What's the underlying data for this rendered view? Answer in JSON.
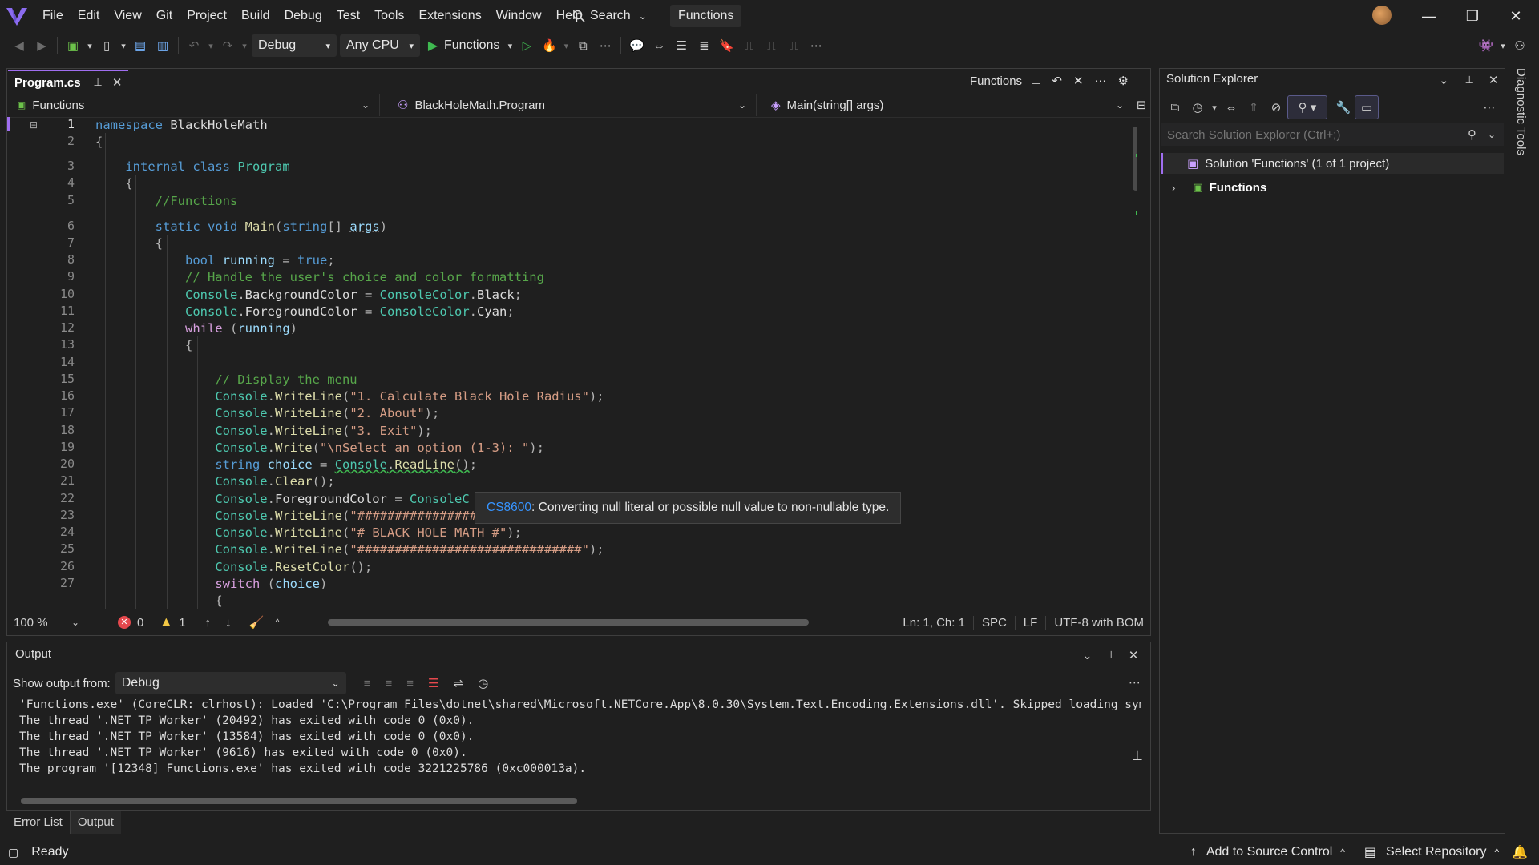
{
  "menu": [
    "File",
    "Edit",
    "View",
    "Git",
    "Project",
    "Build",
    "Debug",
    "Test",
    "Tools",
    "Extensions",
    "Window",
    "Help"
  ],
  "search_label": "Search",
  "solution_title": "Functions",
  "toolbar": {
    "config": "Debug",
    "platform": "Any CPU",
    "run_target": "Functions"
  },
  "editor": {
    "tab_label": "Program.cs",
    "right_title": "Functions",
    "nav_project": "Functions",
    "nav_class": "BlackHoleMath.Program",
    "nav_member": "Main(string[] args)",
    "line_numbers": [
      "1",
      "2",
      "3",
      "4",
      "5",
      "6",
      "7",
      "8",
      "9",
      "10",
      "11",
      "12",
      "13",
      "14",
      "15",
      "16",
      "17",
      "18",
      "19",
      "20",
      "21",
      "22",
      "23",
      "24",
      "25",
      "26",
      "27"
    ],
    "tooltip_code": "CS8600",
    "tooltip_text": ": Converting null literal or possible null value to non-nullable type.",
    "zoom": "100 %",
    "errors": "0",
    "warnings": "1",
    "position": "Ln: 1, Ch: 1",
    "whitespace": "SPC",
    "line_ending": "LF",
    "encoding": "UTF-8 with BOM"
  },
  "output": {
    "title": "Output",
    "show_from_label": "Show output from:",
    "source": "Debug",
    "lines": [
      "'Functions.exe' (CoreCLR: clrhost): Loaded 'C:\\Program Files\\dotnet\\shared\\Microsoft.NETCore.App\\8.0.30\\System.Text.Encoding.Extensions.dll'. Skipped loading symbols. Module",
      "The thread '.NET TP Worker' (20492) has exited with code 0 (0x0).",
      "The thread '.NET TP Worker' (13584) has exited with code 0 (0x0).",
      "The thread '.NET TP Worker' (9616) has exited with code 0 (0x0).",
      "The program '[12348] Functions.exe' has exited with code 3221225786 (0xc000013a)."
    ]
  },
  "bottom_tabs": [
    "Error List",
    "Output"
  ],
  "solution_explorer": {
    "title": "Solution Explorer",
    "search_placeholder": "Search Solution Explorer (Ctrl+;)",
    "solution_label": "Solution 'Functions' (1 of 1 project)",
    "project_label": "Functions"
  },
  "diagnostic_tools": "Diagnostic Tools",
  "statusbar": {
    "ready": "Ready",
    "source_control": "Add to Source Control",
    "repository": "Select Repository"
  },
  "colors": {
    "accent": "#a06ef0",
    "keyword": "#569cd6",
    "type": "#4ec9b0",
    "string": "#d69d85",
    "comment": "#57a64a",
    "method": "#dcdcaa",
    "run_green": "#3fb950",
    "error_red": "#e5484d",
    "warning_yellow": "#f2c744"
  }
}
